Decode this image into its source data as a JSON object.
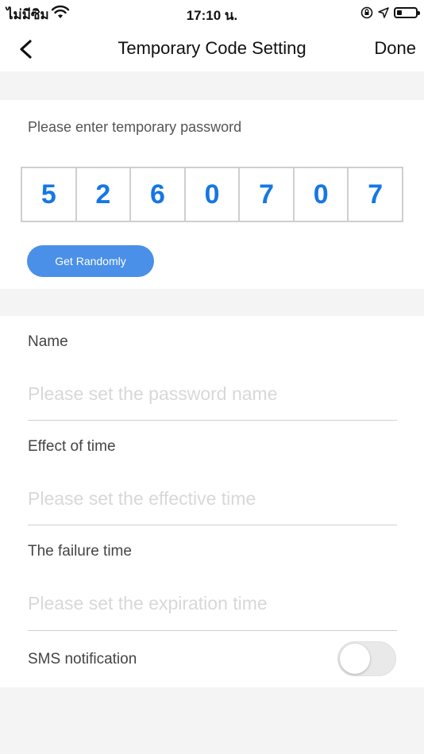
{
  "status_bar": {
    "carrier": "ไม่มีซิม",
    "time": "17:10 น."
  },
  "header": {
    "title": "Temporary Code Setting",
    "done_label": "Done"
  },
  "code_section": {
    "label": "Please enter temporary password",
    "digits": [
      "5",
      "2",
      "6",
      "0",
      "7",
      "0",
      "7"
    ],
    "random_button_label": "Get Randomly"
  },
  "form": {
    "name": {
      "label": "Name",
      "placeholder": "Please set the password name",
      "value": ""
    },
    "effect_time": {
      "label": "Effect of time",
      "placeholder": "Please set the effective time",
      "value": ""
    },
    "failure_time": {
      "label": "The failure time",
      "placeholder": "Please set the expiration time",
      "value": ""
    },
    "sms": {
      "label": "SMS notification",
      "enabled": false
    }
  },
  "colors": {
    "accent": "#4a90e8",
    "digit": "#1677e5",
    "background": "#f4f4f4"
  }
}
